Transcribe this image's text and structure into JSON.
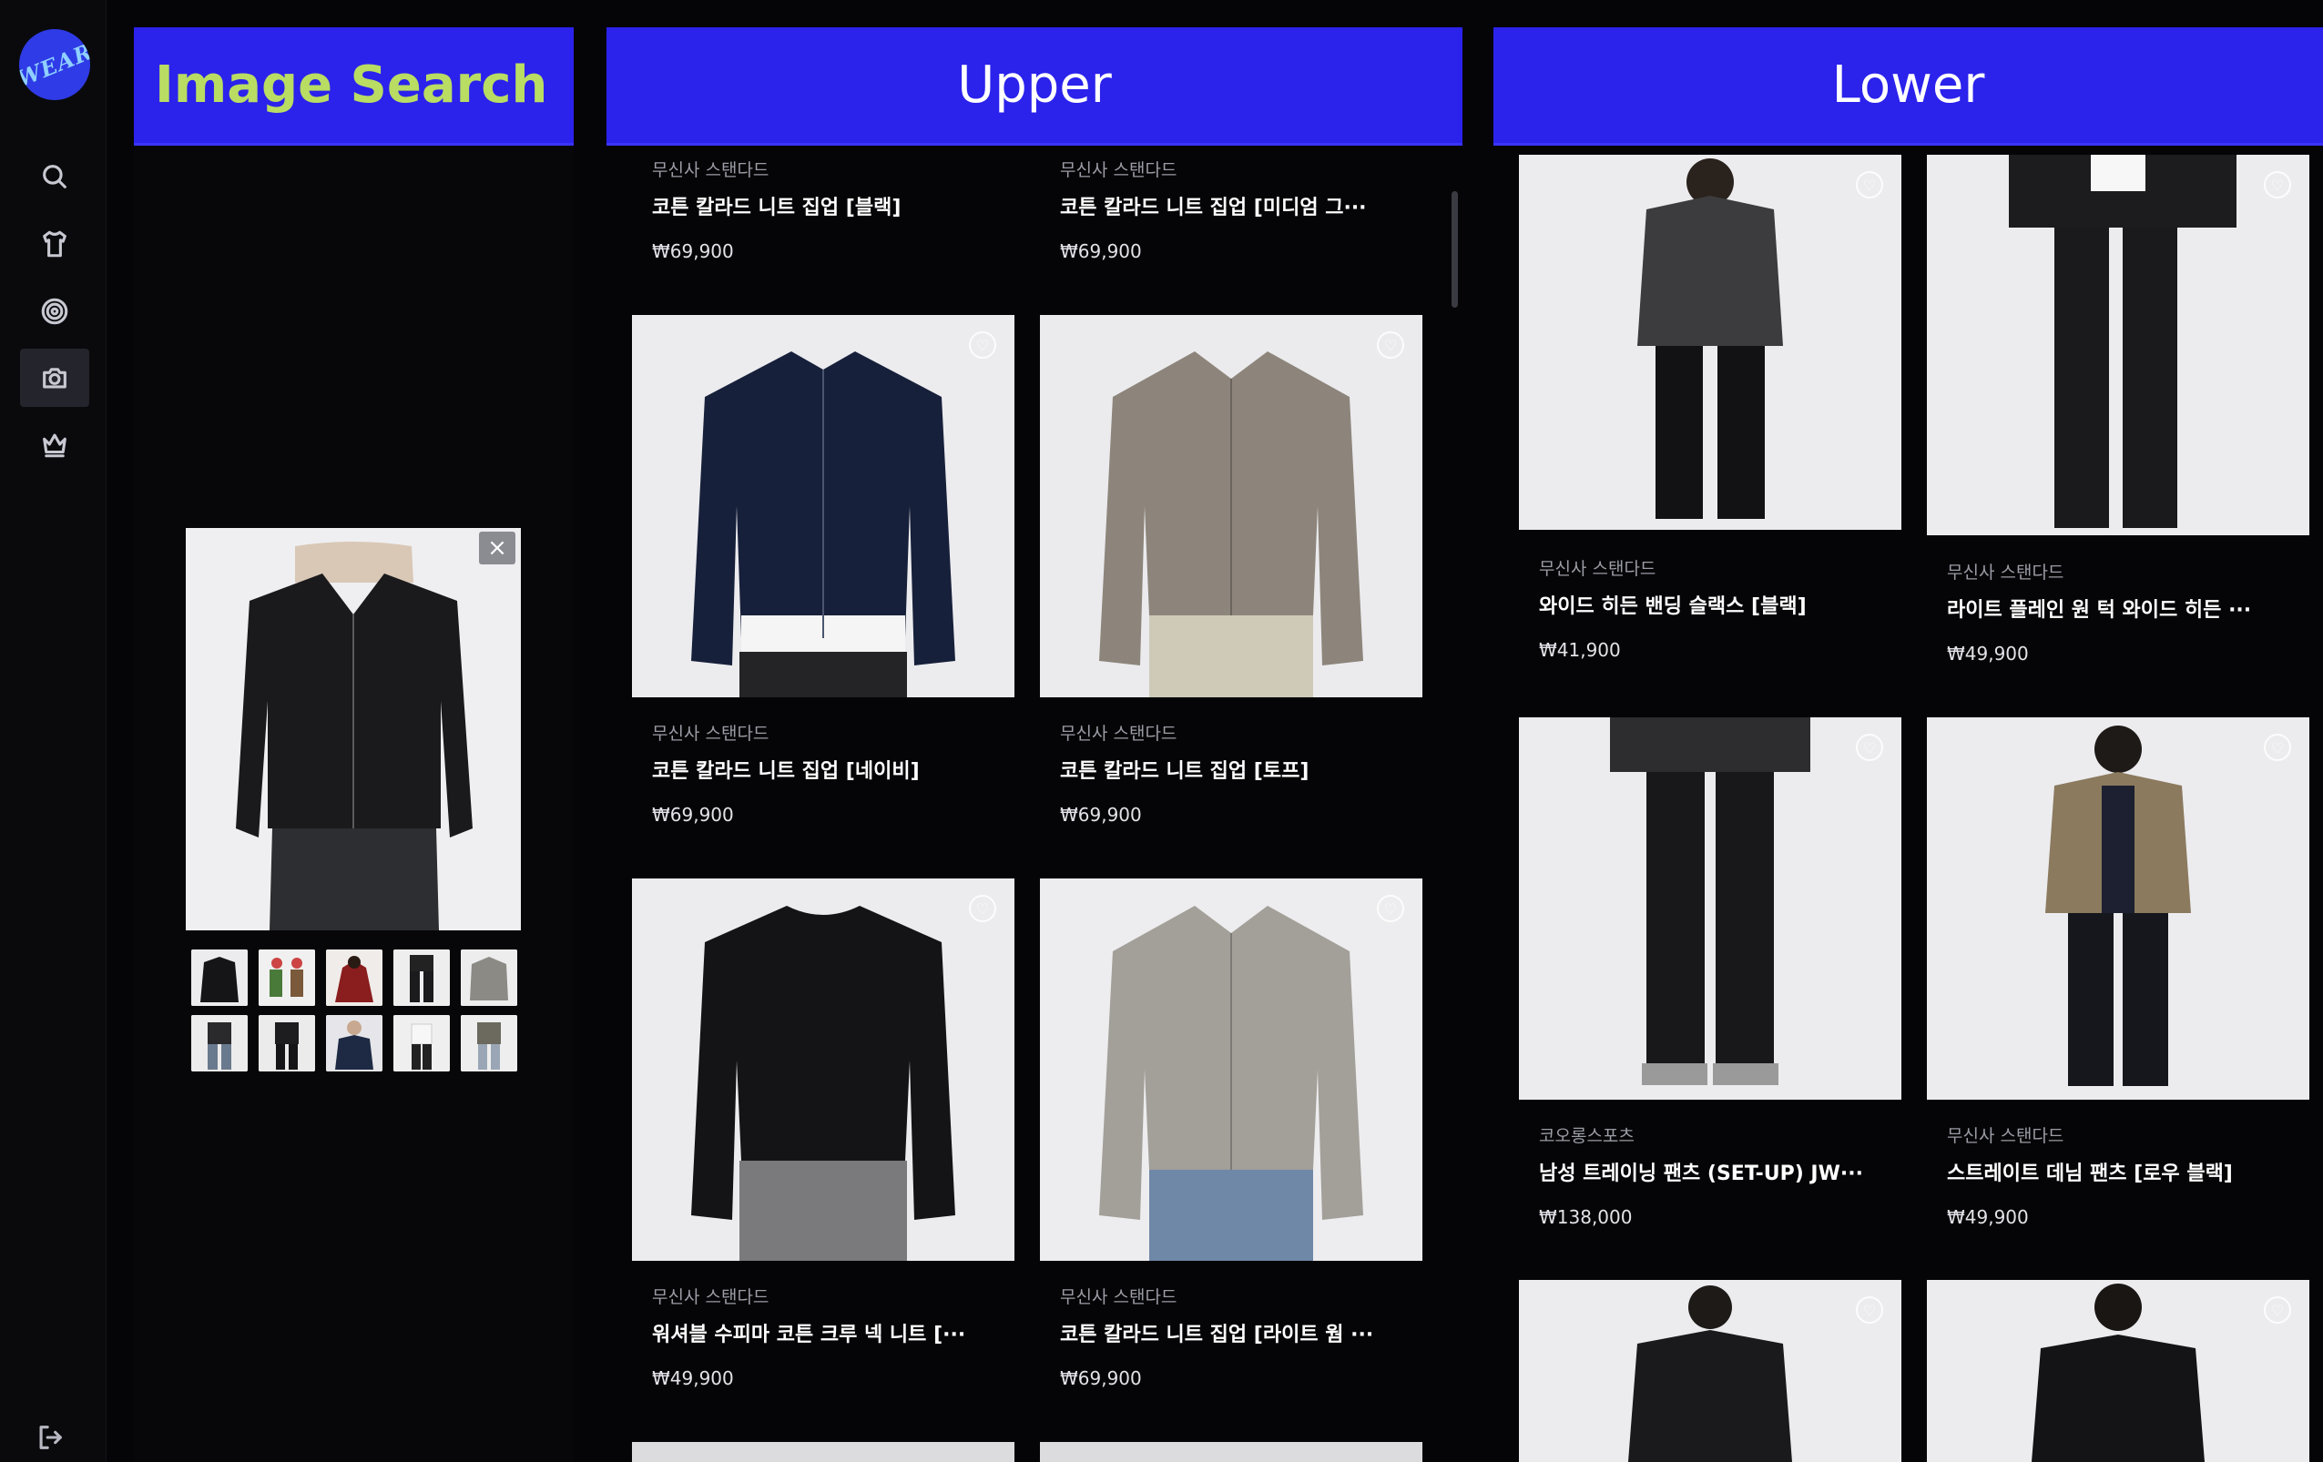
{
  "app": {
    "logo_text": "WEAR",
    "brand_color": "#2b22ec"
  },
  "sidebar": {
    "items": [
      {
        "icon": "search-icon"
      },
      {
        "icon": "shirt-icon"
      },
      {
        "icon": "target-icon"
      },
      {
        "icon": "camera-icon",
        "active": true
      },
      {
        "icon": "crown-icon"
      }
    ],
    "logout_icon": "logout-icon"
  },
  "search_panel": {
    "title": "Image Search",
    "close_symbol": "×",
    "thumbnails": 10
  },
  "upper": {
    "title": "Upper",
    "cards": [
      {
        "brand": "무신사 스탠다드",
        "name": "코튼 칼라드 니트 집업 [블랙]",
        "price": "₩69,900"
      },
      {
        "brand": "무신사 스탠다드",
        "name": "코튼 칼라드 니트 집업 [미디엄 그···",
        "price": "₩69,900"
      },
      {
        "brand": "무신사 스탠다드",
        "name": "코튼 칼라드 니트 집업 [네이비]",
        "price": "₩69,900"
      },
      {
        "brand": "무신사 스탠다드",
        "name": "코튼 칼라드 니트 집업 [토프]",
        "price": "₩69,900"
      },
      {
        "brand": "무신사 스탠다드",
        "name": "워셔블 수피마 코튼 크루 넥 니트 [···",
        "price": "₩49,900"
      },
      {
        "brand": "무신사 스탠다드",
        "name": "코튼 칼라드 니트 집업 [라이트 웜 ···",
        "price": "₩69,900"
      }
    ]
  },
  "lower": {
    "title": "Lower",
    "cards": [
      {
        "brand": "무신사 스탠다드",
        "name": "와이드 히든 밴딩 슬랙스 [블랙]",
        "price": "₩41,900"
      },
      {
        "brand": "무신사 스탠다드",
        "name": "라이트 플레인 원 턱 와이드 히든 ···",
        "price": "₩49,900"
      },
      {
        "brand": "코오롱스포츠",
        "name": "남성 트레이닝 팬츠 (SET-UP) JW···",
        "price": "₩138,000"
      },
      {
        "brand": "무신사 스탠다드",
        "name": "스트레이트 데님 팬츠 [로우 블랙]",
        "price": "₩49,900"
      }
    ]
  }
}
